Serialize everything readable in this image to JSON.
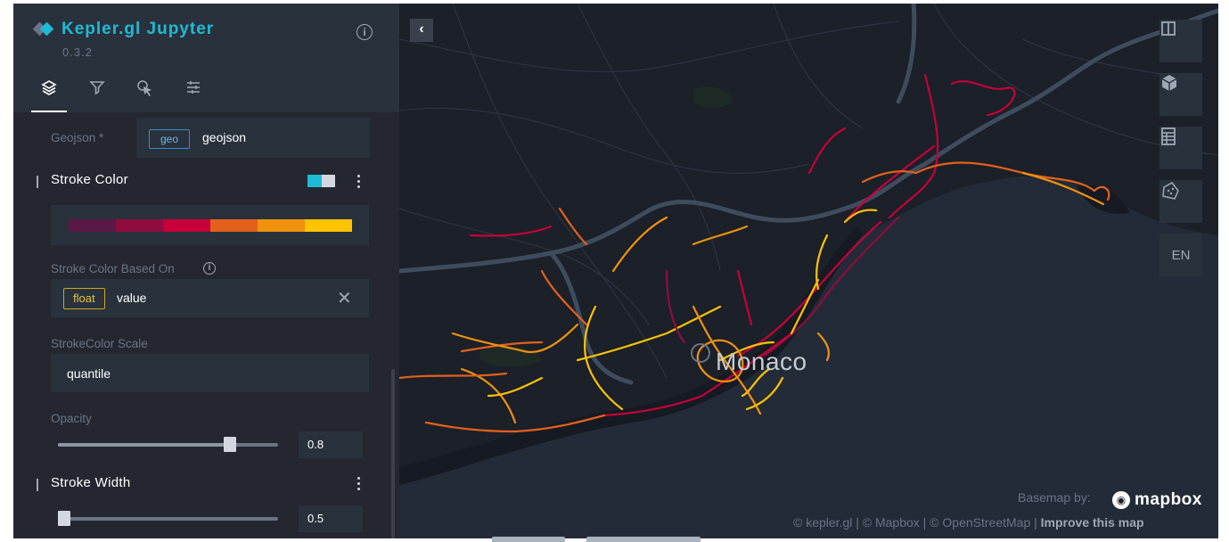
{
  "header": {
    "app_name": "Kepler.gl Jupyter",
    "version": "0.3.2"
  },
  "tabs": [
    {
      "name": "layers-icon"
    },
    {
      "name": "filter-icon"
    },
    {
      "name": "interaction-icon"
    },
    {
      "name": "map-settings-icon"
    }
  ],
  "layer_config": {
    "geojson_label": "Geojson *",
    "dataset_badge": "geo",
    "dataset_name": "geojson",
    "stroke_color": {
      "title": "Stroke Color",
      "palette": [
        "#5a1846",
        "#900c3f",
        "#c70039",
        "#e3611c",
        "#f1920e",
        "#ffc300"
      ],
      "based_on_label": "Stroke Color Based On",
      "field_type": "float",
      "field_name": "value",
      "clear_symbol": "✕"
    },
    "scale": {
      "label": "StrokeColor Scale",
      "value": "quantile"
    },
    "opacity": {
      "label": "Opacity",
      "value": "0.8",
      "level": 0.8
    },
    "stroke_width": {
      "title": "Stroke Width",
      "value": "0.5",
      "level": 0.0
    }
  },
  "map": {
    "city_label": "Monaco",
    "controls": [
      {
        "name": "split-map-icon"
      },
      {
        "name": "3d-view-icon"
      },
      {
        "name": "legend-icon"
      },
      {
        "name": "draw-polygon-icon"
      },
      {
        "name": "locale-button",
        "label": "EN"
      }
    ],
    "attribution": {
      "basemap_by": "Basemap by:",
      "mapbox": "mapbox",
      "line_prefix": "© kepler.gl | © Mapbox | © OpenStreetMap |",
      "improve": "Improve this map"
    }
  },
  "colors": {
    "accent": "#1fbad6",
    "panel": "#242730",
    "map_bg": "#1b2029",
    "sea": "#232b38"
  }
}
